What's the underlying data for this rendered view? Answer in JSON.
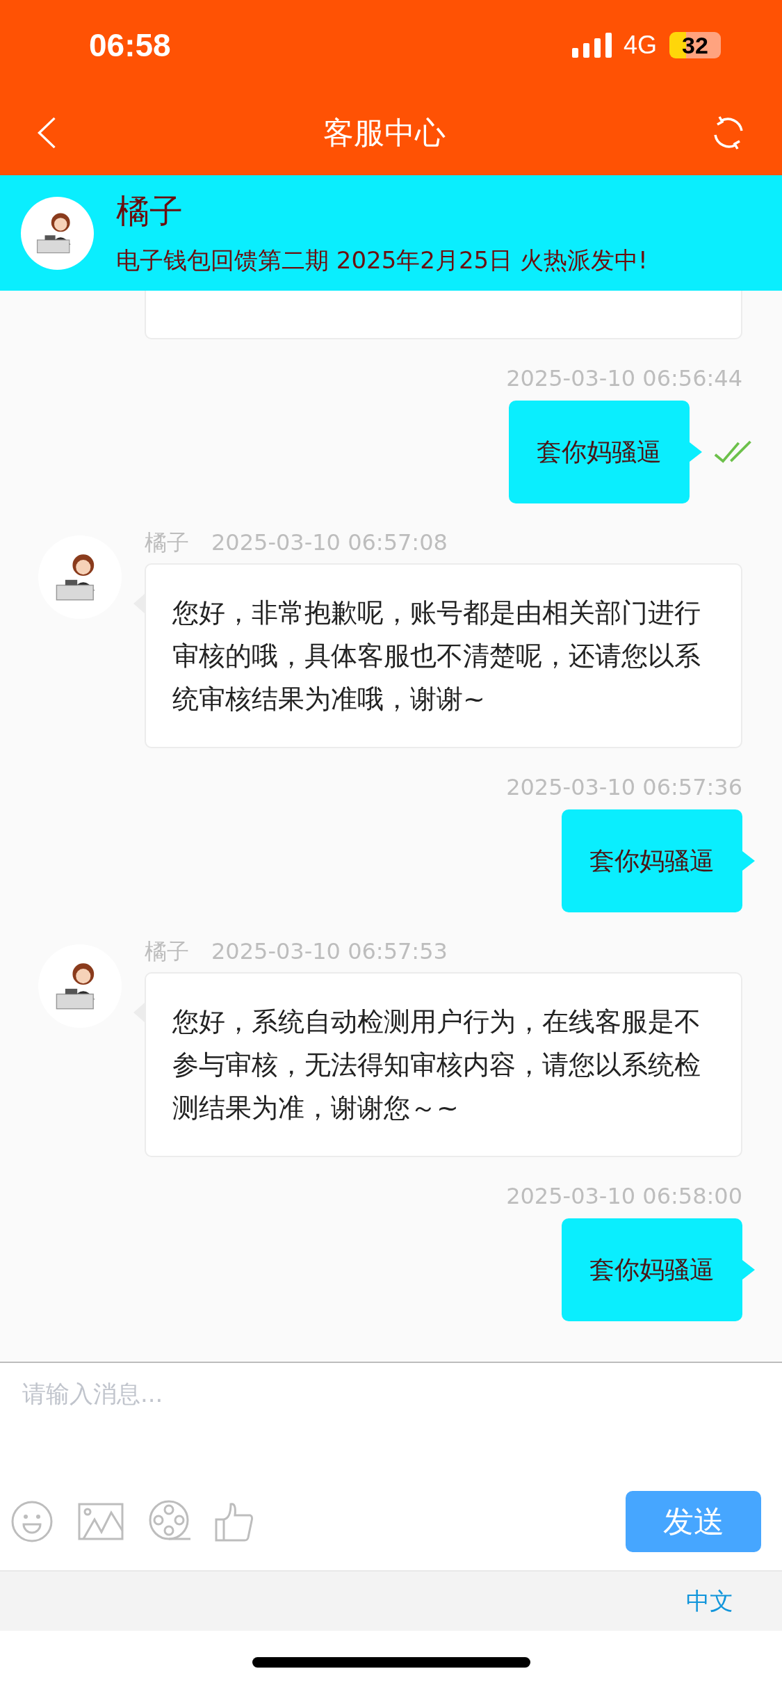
{
  "status_bar": {
    "time": "06:58",
    "network": "4G",
    "battery": "32"
  },
  "nav": {
    "title": "客服中心"
  },
  "banner": {
    "name": "橘子",
    "notice": "电子钱包回馈第二期 2025年2月25日 火热派发中!"
  },
  "messages": [
    {
      "kind": "sent",
      "time": "2025-03-10 06:56:44",
      "text": "套你妈骚逼",
      "read": true
    },
    {
      "kind": "received",
      "sender": "橘子",
      "time": "2025-03-10 06:57:08",
      "text": "您好，非常抱歉呢，账号都是由相关部门进行审核的哦，具体客服也不清楚呢，还请您以系统审核结果为准哦，谢谢~"
    },
    {
      "kind": "sent",
      "time": "2025-03-10 06:57:36",
      "text": "套你妈骚逼",
      "read": false
    },
    {
      "kind": "received",
      "sender": "橘子",
      "time": "2025-03-10 06:57:53",
      "text": "您好，系统自动检测用户行为，在线客服是不参与审核，无法得知审核内容，请您以系统检测结果为准，谢谢您～~"
    },
    {
      "kind": "sent",
      "time": "2025-03-10 06:58:00",
      "text": "套你妈骚逼",
      "read": false
    }
  ],
  "composer": {
    "placeholder": "请输入消息...",
    "send": "发送"
  },
  "language": "中文"
}
